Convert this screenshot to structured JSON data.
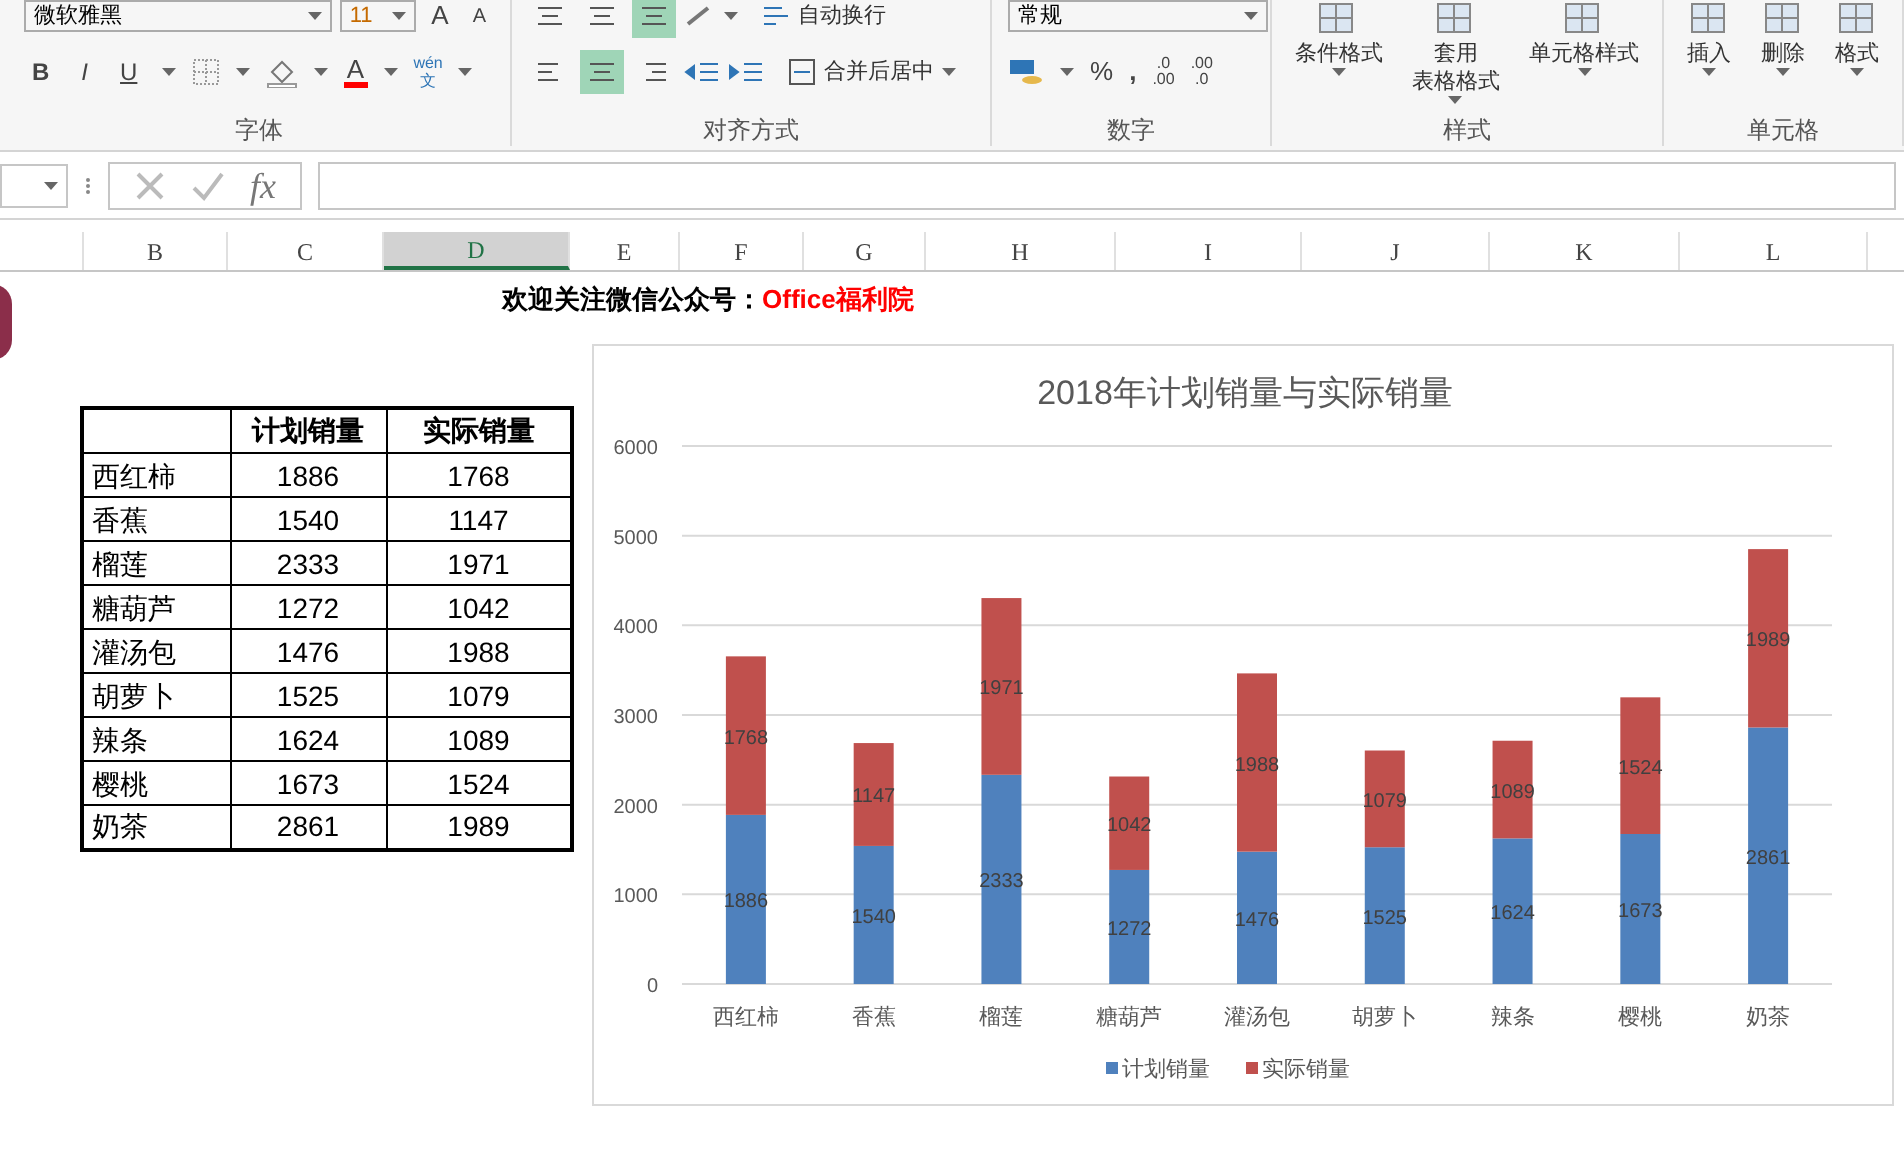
{
  "ribbon": {
    "groups": [
      {
        "kind": "font",
        "label": "字体",
        "font_name": "微软雅黑",
        "font_size": "11",
        "grow": "A",
        "shrink": "A",
        "bold": "B",
        "italic": "I",
        "underline": "U",
        "font_color": "A",
        "phonetic_top": "wén",
        "phonetic_bottom": "文"
      },
      {
        "kind": "align",
        "label": "对齐方式",
        "wrap": "自动换行",
        "merge": "合并后居中",
        "center_selected": true,
        "bottom_selected": true
      },
      {
        "kind": "number",
        "label": "数字",
        "format": "常规",
        "percent": "%",
        "comma": ",",
        "inc_top": ".0",
        "inc_bottom": ".00",
        "dec_top": ".00",
        "dec_bottom": ".0"
      },
      {
        "kind": "styles",
        "label": "样式",
        "buttons": [
          {
            "lines": [
              "条件格式"
            ]
          },
          {
            "lines": [
              "套用",
              "表格格式"
            ]
          },
          {
            "lines": [
              "单元格样式"
            ]
          }
        ]
      },
      {
        "kind": "cells",
        "label": "单元格",
        "buttons": [
          {
            "lines": [
              "插入"
            ]
          },
          {
            "lines": [
              "删除"
            ]
          },
          {
            "lines": [
              "格式"
            ]
          }
        ]
      }
    ]
  },
  "formula_bar": {
    "fx": "fx"
  },
  "columns": [
    {
      "label": "B",
      "selected": false
    },
    {
      "label": "C",
      "selected": false
    },
    {
      "label": "D",
      "selected": true
    },
    {
      "label": "E",
      "selected": false
    },
    {
      "label": "F",
      "selected": false
    },
    {
      "label": "G",
      "selected": false
    },
    {
      "label": "H",
      "selected": false
    },
    {
      "label": "I",
      "selected": false
    },
    {
      "label": "J",
      "selected": false
    },
    {
      "label": "K",
      "selected": false
    },
    {
      "label": "L",
      "selected": false
    }
  ],
  "banner": {
    "text": "欢迎关注微信公众号：",
    "highlight": "Office福利院"
  },
  "table": {
    "headers": [
      "计划销量",
      "实际销量"
    ],
    "rows": [
      [
        "西红柿",
        "1886",
        "1768"
      ],
      [
        "香蕉",
        "1540",
        "1147"
      ],
      [
        "榴莲",
        "2333",
        "1971"
      ],
      [
        "糖葫芦",
        "1272",
        "1042"
      ],
      [
        "灌汤包",
        "1476",
        "1988"
      ],
      [
        "胡萝卜",
        "1525",
        "1079"
      ],
      [
        "辣条",
        "1624",
        "1089"
      ],
      [
        "樱桃",
        "1673",
        "1524"
      ],
      [
        "奶茶",
        "2861",
        "1989"
      ]
    ]
  },
  "chart_data": {
    "type": "bar",
    "title": "2018年计划销量与实际销量",
    "stacked": true,
    "data_labels": true,
    "categories": [
      "西红柿",
      "香蕉",
      "榴莲",
      "糖葫芦",
      "灌汤包",
      "胡萝卜",
      "辣条",
      "樱桃",
      "奶茶"
    ],
    "series": [
      {
        "name": "计划销量",
        "color": "#4f81bd",
        "values": [
          1886,
          1540,
          2333,
          1272,
          1476,
          1525,
          1624,
          1673,
          2861
        ],
        "value_labels": [
          "1886",
          "1540",
          "2333",
          "1272",
          "1476",
          "1525",
          "1624",
          "1673",
          "2861"
        ]
      },
      {
        "name": "实际销量",
        "color": "#c0504d",
        "values": [
          1768,
          1147,
          1971,
          1042,
          1988,
          1079,
          1089,
          1524,
          1989
        ],
        "value_labels": [
          "1768",
          "1147",
          "1971",
          "1042",
          "1988",
          "1079",
          "1089",
          "1524",
          "1989"
        ]
      }
    ],
    "ylim": [
      0,
      6000
    ],
    "grid": true,
    "legend": "bottom",
    "yticks": [
      0,
      1000,
      2000,
      3000,
      4000,
      5000,
      6000
    ]
  }
}
